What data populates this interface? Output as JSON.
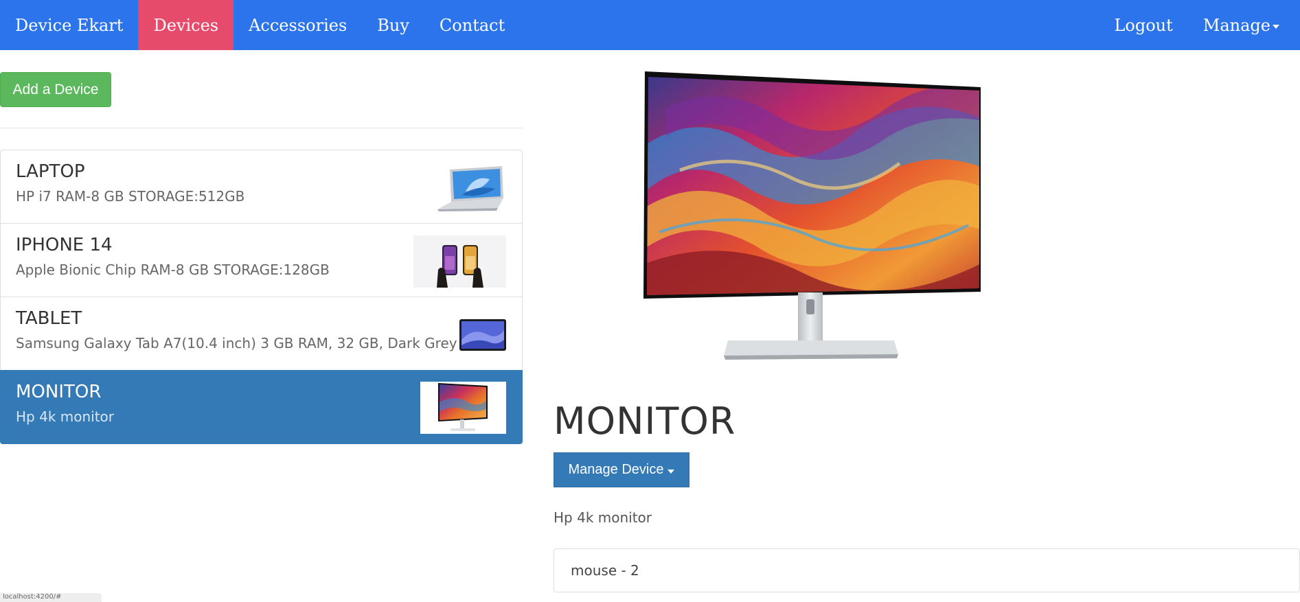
{
  "navbar": {
    "brand": "Device Ekart",
    "items": [
      {
        "label": "Devices",
        "active": true
      },
      {
        "label": "Accessories",
        "active": false
      },
      {
        "label": "Buy",
        "active": false
      },
      {
        "label": "Contact",
        "active": false
      }
    ],
    "logout": "Logout",
    "manage": "Manage",
    "colors": {
      "bar": "#2b74eb",
      "active": "#e64b6b"
    }
  },
  "add_device_label": "Add a Device",
  "devices": [
    {
      "title": "LAPTOP",
      "desc": "HP i7 RAM-8 GB STORAGE:512GB",
      "thumb_icon": "laptop-thumbnail"
    },
    {
      "title": "IPHONE 14",
      "desc": "Apple Bionic Chip RAM-8 GB STORAGE:128GB",
      "thumb_icon": "iphone-thumbnail"
    },
    {
      "title": "TABLET",
      "desc": "Samsung Galaxy Tab A7(10.4 inch) 3 GB RAM, 32 GB, Dark Grey",
      "thumb_icon": "tablet-thumbnail"
    },
    {
      "title": "MONITOR",
      "desc": "Hp 4k monitor",
      "thumb_icon": "monitor-thumbnail",
      "active": true
    }
  ],
  "detail": {
    "title": "MONITOR",
    "manage_button": "Manage Device",
    "description": "Hp 4k monitor",
    "accessory": "mouse - 2"
  },
  "status_bar_text": "localhost:4200/#"
}
